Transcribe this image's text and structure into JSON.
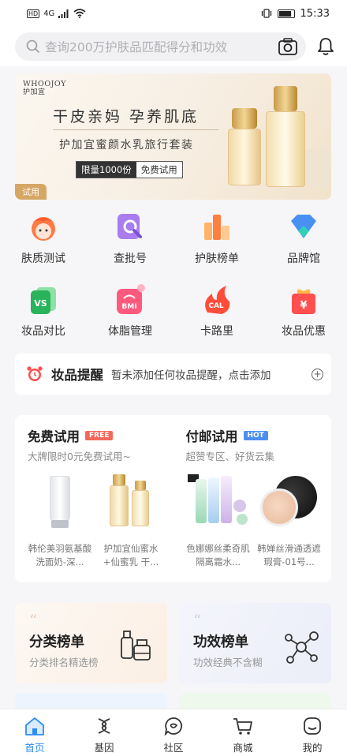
{
  "status_bar": {
    "network": "4G",
    "time": "15:33"
  },
  "search": {
    "placeholder": "查询200万护肤品匹配得分和功效"
  },
  "banner": {
    "brand_en": "WHOOJOY",
    "brand_cn": "护加宜",
    "title": "干皮亲妈  孕养肌底",
    "subtitle": "护加宜蜜颜水乳旅行套装",
    "limit": "限量1000份",
    "cta": "免费试用",
    "tag": "试用"
  },
  "quick_icons": [
    {
      "label": "肤质测试",
      "icon": "face-test-icon"
    },
    {
      "label": "查批号",
      "icon": "batch-search-icon"
    },
    {
      "label": "护肤榜单",
      "icon": "ranking-bars-icon"
    },
    {
      "label": "品牌馆",
      "icon": "brand-diamond-icon"
    },
    {
      "label": "妆品对比",
      "icon": "compare-vs-icon"
    },
    {
      "label": "体脂管理",
      "icon": "bmi-scale-icon",
      "icon_text": "BMI"
    },
    {
      "label": "卡路里",
      "icon": "calorie-flame-icon",
      "icon_text": "CAL"
    },
    {
      "label": "妆品优惠",
      "icon": "gift-coupon-icon"
    }
  ],
  "reminder": {
    "title": "妆品提醒",
    "text": "暂未添加任何妆品提醒，点击添加"
  },
  "free_trial": {
    "title": "免费试用",
    "badge": "FREE",
    "subtitle": "大牌限时0元免费试用~",
    "products": [
      {
        "name": "韩伦美羽氨基酸洗面奶-深..."
      },
      {
        "name": "护加宜仙蜜水+仙蜜乳 干..."
      }
    ]
  },
  "paid_trial": {
    "title": "付邮试用",
    "badge": "HOT",
    "subtitle": "超赞专区、好货云集",
    "products": [
      {
        "name": "色娜娜丝柔奇肌隔离霜水..."
      },
      {
        "name": "韩婵丝滑通透遮瑕膏-01号..."
      }
    ]
  },
  "rankings": [
    {
      "title": "分类榜单",
      "subtitle": "分类排名精选榜",
      "icon": "bottles-icon"
    },
    {
      "title": "功效榜单",
      "subtitle": "功效经典不含糊",
      "icon": "molecule-icon"
    }
  ],
  "tabs": [
    {
      "label": "首页",
      "icon": "home-icon",
      "active": true
    },
    {
      "label": "基因",
      "icon": "dna-icon"
    },
    {
      "label": "社区",
      "icon": "community-icon"
    },
    {
      "label": "商城",
      "icon": "cart-icon"
    },
    {
      "label": "我的",
      "icon": "profile-icon"
    }
  ],
  "colors": {
    "accent": "#2e8ef0",
    "free_badge": "#f4695c",
    "hot_badge": "#4c8ff1",
    "trial_tag": "#d6a665"
  }
}
